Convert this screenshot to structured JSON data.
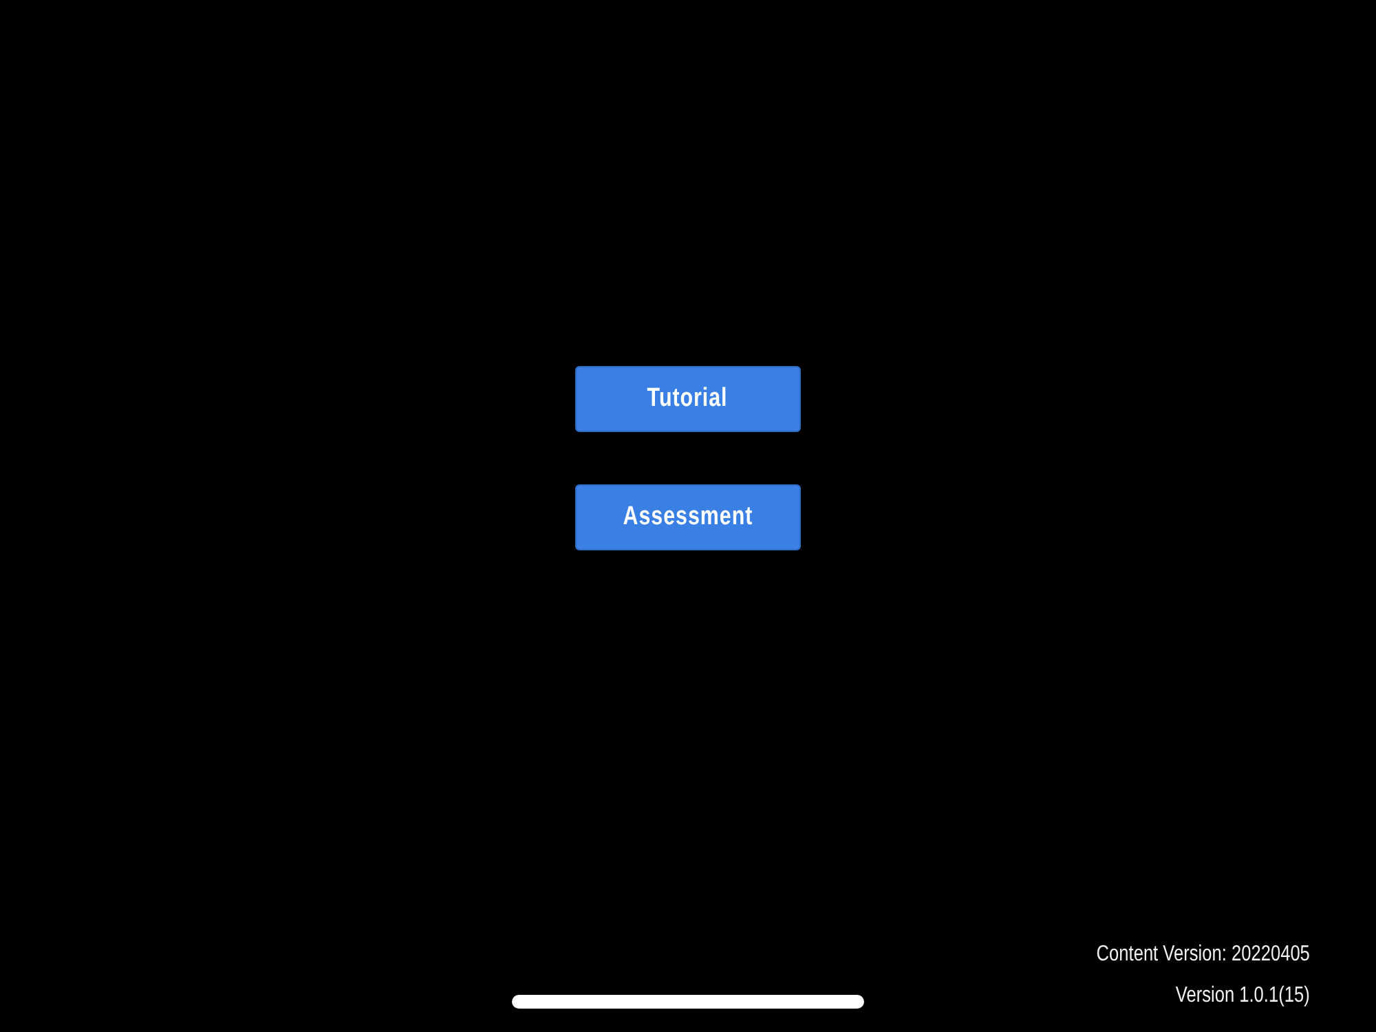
{
  "buttons": [
    {
      "label": "Tutorial"
    },
    {
      "label": "Assessment"
    }
  ],
  "footer": {
    "content_version": "Content Version: 20220405",
    "version": "Version 1.0.1(15)"
  }
}
